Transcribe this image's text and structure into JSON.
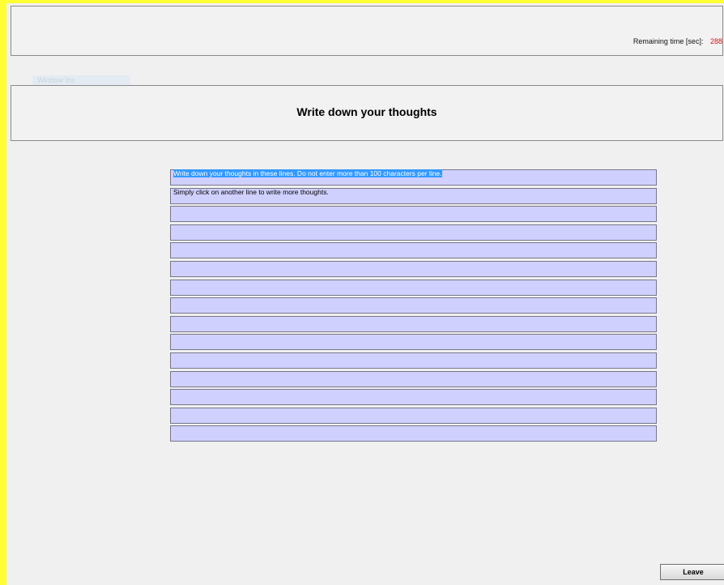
{
  "timer": {
    "label": "Remaining time [sec]:",
    "value": "288"
  },
  "header": {
    "title": "Write down your thoughts"
  },
  "ghost_tab": {
    "label": "Window Ins"
  },
  "lines": [
    "Write down your thoughts in these lines. Do not enter more than 100 characters per line.",
    "Simply click on another line to write more thoughts.",
    "",
    "",
    "",
    "",
    "",
    "",
    "",
    "",
    "",
    "",
    "",
    "",
    ""
  ],
  "leave_button": {
    "label": "Leave"
  },
  "colors": {
    "border_accent": "#ffff33",
    "line_background": "#d0d0ff",
    "timer_value": "#e01010",
    "selection": "#3399ff"
  }
}
